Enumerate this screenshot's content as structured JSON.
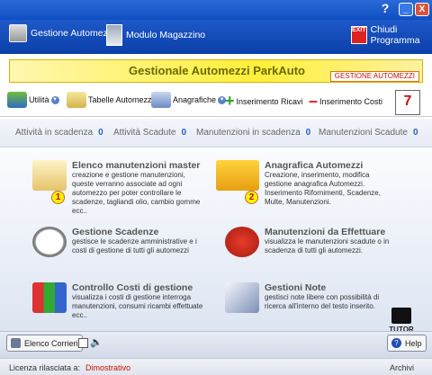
{
  "window": {
    "help_glyph": "?",
    "minimize_glyph": "_",
    "close_glyph": "X"
  },
  "topnav": {
    "fleet_label": "Gestione Automezzi",
    "warehouse_label": "Modulo Magazzino",
    "exit_label": "Chiudi Programma",
    "exit_icon_text": "EXIT"
  },
  "banner": {
    "title": "Gestionale Automezzi ParkAuto",
    "tag": "GESTIONE AUTOMEZZI"
  },
  "toolbar": {
    "utility": "Utilità",
    "tables": "Tabelle Automezzi",
    "records": "Anagrafiche",
    "add_income": "Inserimento Ricavi",
    "add_cost": "Inserimento Costi",
    "calendar_day": "7"
  },
  "counters": [
    {
      "label": "Attività in scadenza",
      "value": "0"
    },
    {
      "label": "Attività Scadute",
      "value": "0"
    },
    {
      "label": "Manutenzioni in scadenza",
      "value": "0"
    },
    {
      "label": "Manutenzioni Scadute",
      "value": "0"
    }
  ],
  "cards": {
    "maintenance_master": {
      "title": "Elenco manutenzioni master",
      "desc": "creazione e gestione manutenzioni, queste verranno associate ad ogni automezzo per poter controllare le scadenze, tagliandi olio, cambio gomme ecc..",
      "step": "1"
    },
    "fleet_registry": {
      "title": "Anagrafica Automezzi",
      "desc": "Creazione, inserimento, modifica gestione anagrafica Automezzi. Inserimento Rifornimenti, Scadenze, Multe, Manutenzioni.",
      "step": "2"
    },
    "deadlines": {
      "title": "Gestione Scadenze",
      "desc": "gestisce le scadenze amministrative e i costi di gestione di tutti gli automezzi"
    },
    "pending_maintenance": {
      "title": "Manutenzioni da Effettuare",
      "desc": "visualizza le manutenzioni scadute o in scadenza di tutti gli automezzi."
    },
    "cost_control": {
      "title": "Controllo Costi di gestione",
      "desc": "visualizza i costi di gestione interroga manutenzioni, consumi ricambi effettuate ecc.."
    },
    "notes": {
      "title": "Gestioni Note",
      "desc": "gestisci note libere con possibilità di ricerca all'interno del testo inserito."
    },
    "tutor_label": "TUTOR"
  },
  "bottom": {
    "couriers_button": "Elenco Corrieri",
    "help_button": "Help",
    "speaker_glyph": "🔈"
  },
  "status": {
    "license_label": "Licenza rilasciata a:",
    "license_value": "Dimostrativo",
    "archive_label": "Archivi"
  },
  "colors": {
    "accent_blue": "#0f4ec2",
    "banner_yellow": "#ffef3a",
    "counter_blue": "#2e5fbf",
    "license_red": "#cc1100"
  }
}
